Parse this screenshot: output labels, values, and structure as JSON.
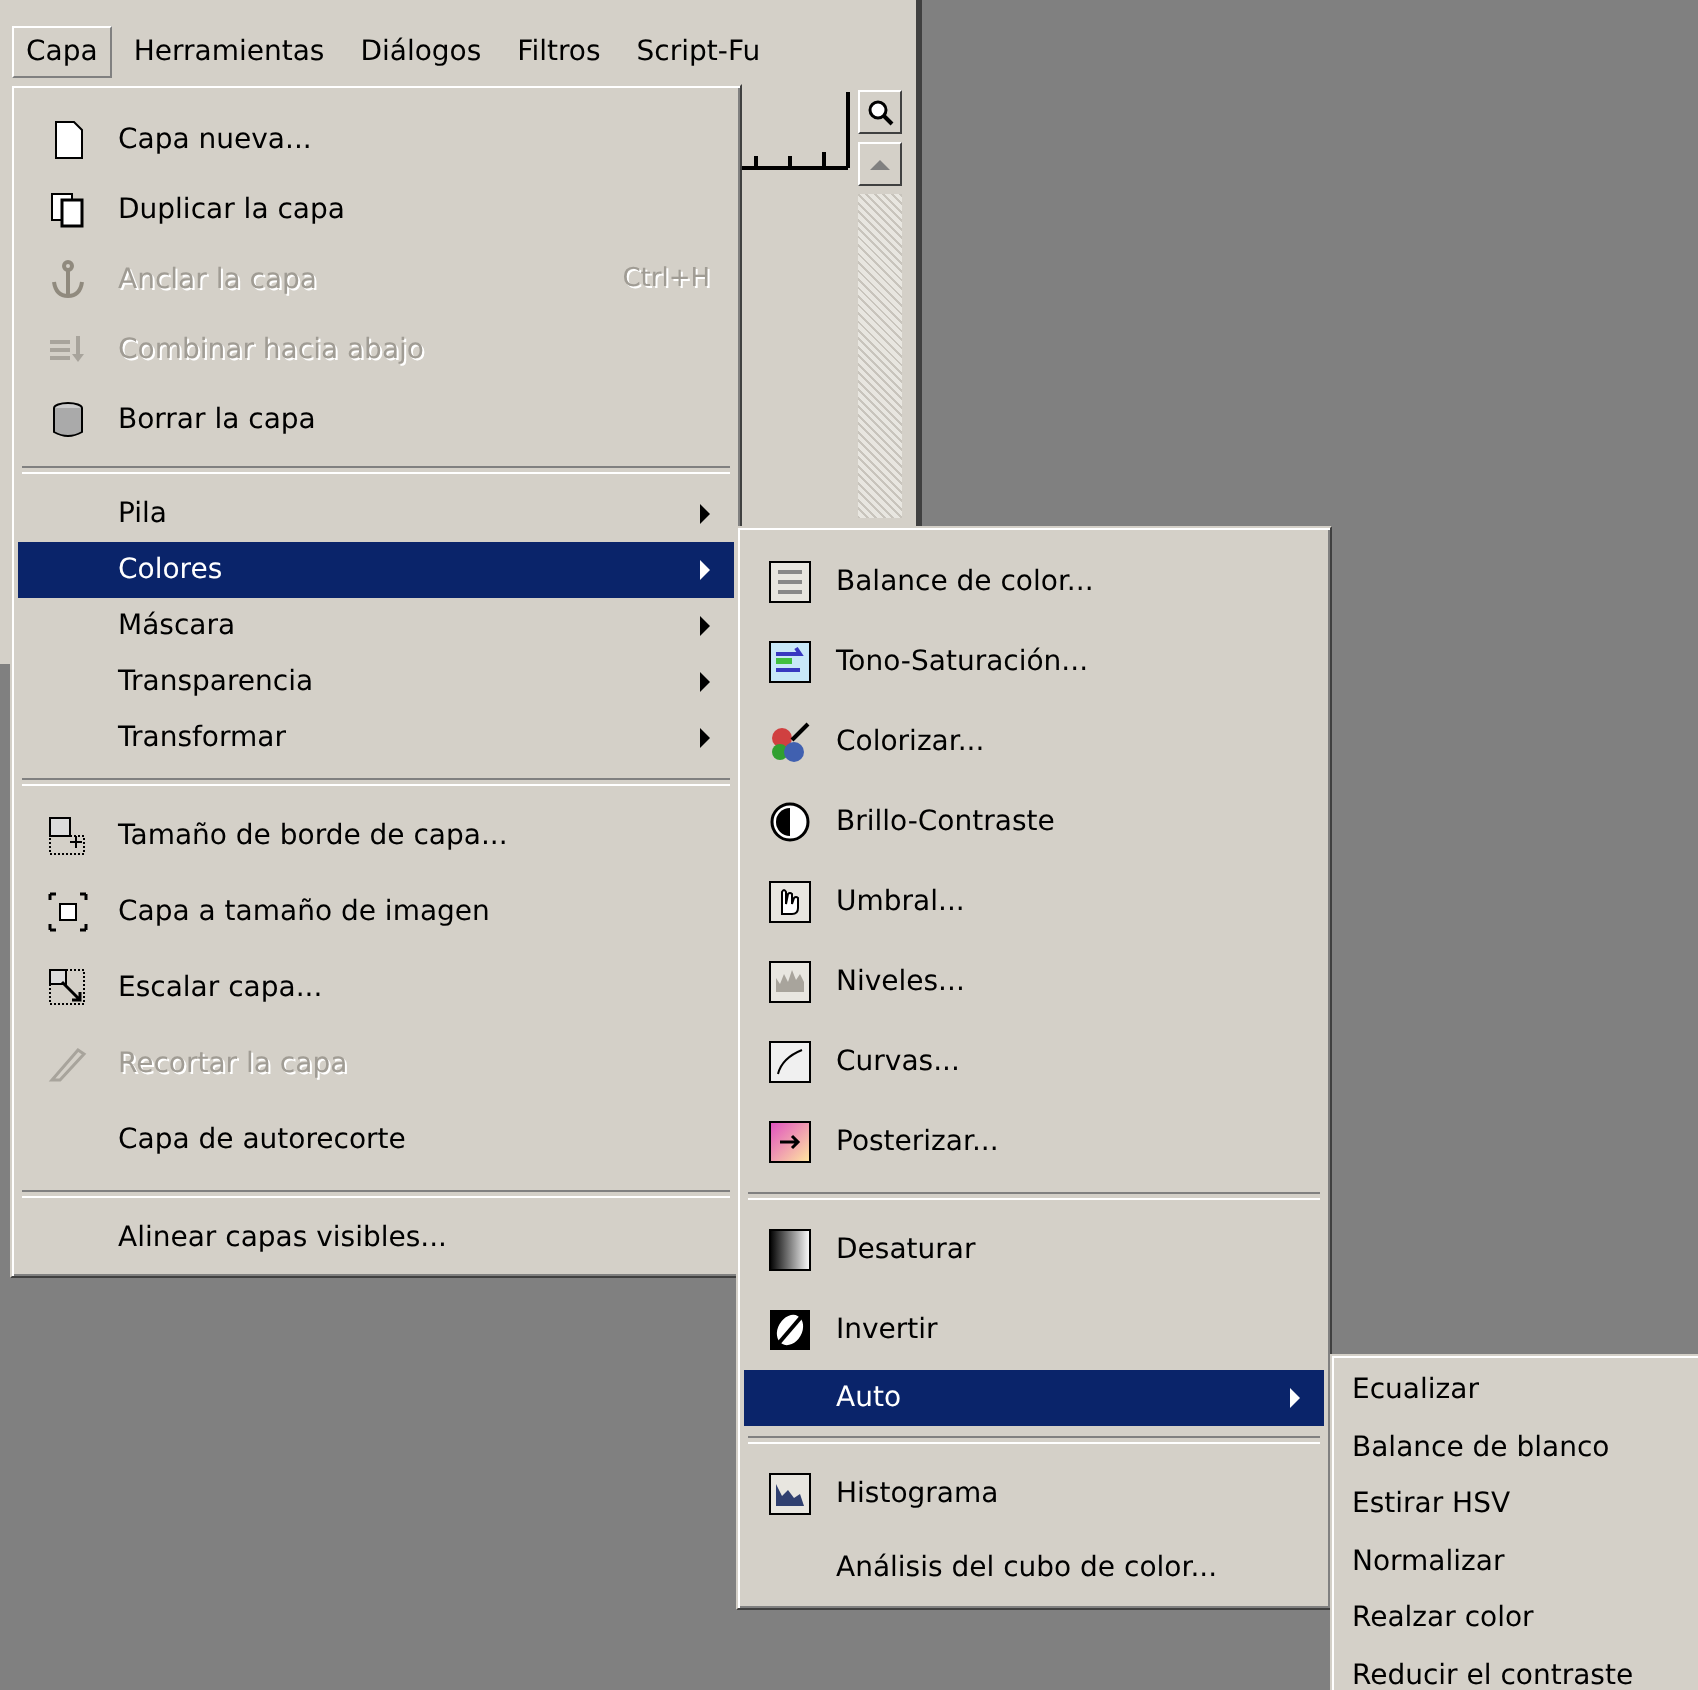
{
  "menubar": [
    {
      "label": "Capa",
      "selected": true
    },
    {
      "label": "Herramientas",
      "selected": false
    },
    {
      "label": "Diálogos",
      "selected": false
    },
    {
      "label": "Filtros",
      "selected": false
    },
    {
      "label": "Script-Fu",
      "selected": false
    }
  ],
  "layer_menu": [
    {
      "kind": "item",
      "label": "Capa nueva...",
      "disabled": false,
      "selected": false,
      "submenu": false
    },
    {
      "kind": "item",
      "label": "Duplicar la capa",
      "disabled": false,
      "selected": false,
      "submenu": false
    },
    {
      "kind": "item",
      "label": "Anclar la capa",
      "shortcut": "Ctrl+H",
      "disabled": true,
      "selected": false,
      "submenu": false
    },
    {
      "kind": "item",
      "label": "Combinar hacia abajo",
      "disabled": true,
      "selected": false,
      "submenu": false
    },
    {
      "kind": "item",
      "label": "Borrar la capa",
      "disabled": false,
      "selected": false,
      "submenu": false
    },
    {
      "kind": "separator"
    },
    {
      "kind": "item",
      "label": "Pila",
      "disabled": false,
      "selected": false,
      "submenu": true
    },
    {
      "kind": "item",
      "label": "Colores",
      "disabled": false,
      "selected": true,
      "submenu": true
    },
    {
      "kind": "item",
      "label": "Máscara",
      "disabled": false,
      "selected": false,
      "submenu": true
    },
    {
      "kind": "item",
      "label": "Transparencia",
      "disabled": false,
      "selected": false,
      "submenu": true
    },
    {
      "kind": "item",
      "label": "Transformar",
      "disabled": false,
      "selected": false,
      "submenu": true
    },
    {
      "kind": "separator"
    },
    {
      "kind": "item",
      "label": "Tamaño de borde de capa...",
      "disabled": false,
      "selected": false,
      "submenu": false
    },
    {
      "kind": "item",
      "label": "Capa a tamaño de imagen",
      "disabled": false,
      "selected": false,
      "submenu": false
    },
    {
      "kind": "item",
      "label": "Escalar capa...",
      "disabled": false,
      "selected": false,
      "submenu": false
    },
    {
      "kind": "item",
      "label": "Recortar la capa",
      "disabled": true,
      "selected": false,
      "submenu": false
    },
    {
      "kind": "item",
      "label": "Capa de autorecorte",
      "disabled": false,
      "selected": false,
      "submenu": false
    },
    {
      "kind": "separator"
    },
    {
      "kind": "item",
      "label": "Alinear capas visibles...",
      "disabled": false,
      "selected": false,
      "submenu": false
    }
  ],
  "colors_menu": [
    {
      "kind": "item",
      "label": "Balance de color...",
      "disabled": false,
      "selected": false,
      "submenu": false
    },
    {
      "kind": "item",
      "label": "Tono-Saturación...",
      "disabled": false,
      "selected": false,
      "submenu": false
    },
    {
      "kind": "item",
      "label": "Colorizar...",
      "disabled": false,
      "selected": false,
      "submenu": false
    },
    {
      "kind": "item",
      "label": "Brillo-Contraste",
      "disabled": false,
      "selected": false,
      "submenu": false
    },
    {
      "kind": "item",
      "label": "Umbral...",
      "disabled": false,
      "selected": false,
      "submenu": false
    },
    {
      "kind": "item",
      "label": "Niveles...",
      "disabled": false,
      "selected": false,
      "submenu": false
    },
    {
      "kind": "item",
      "label": "Curvas...",
      "disabled": false,
      "selected": false,
      "submenu": false
    },
    {
      "kind": "item",
      "label": "Posterizar...",
      "disabled": false,
      "selected": false,
      "submenu": false
    },
    {
      "kind": "separator"
    },
    {
      "kind": "item",
      "label": "Desaturar",
      "disabled": false,
      "selected": false,
      "submenu": false
    },
    {
      "kind": "item",
      "label": "Invertir",
      "disabled": false,
      "selected": false,
      "submenu": false
    },
    {
      "kind": "item",
      "label": "Auto",
      "disabled": false,
      "selected": true,
      "submenu": true
    },
    {
      "kind": "separator"
    },
    {
      "kind": "item",
      "label": "Histograma",
      "disabled": false,
      "selected": false,
      "submenu": false
    },
    {
      "kind": "item",
      "label": "Análisis del cubo de color...",
      "disabled": false,
      "selected": false,
      "submenu": false
    }
  ],
  "auto_menu": [
    {
      "kind": "item",
      "label": "Ecualizar",
      "disabled": false,
      "selected": false,
      "submenu": false
    },
    {
      "kind": "item",
      "label": "Balance de blanco",
      "disabled": false,
      "selected": false,
      "submenu": false
    },
    {
      "kind": "item",
      "label": "Estirar HSV",
      "disabled": false,
      "selected": false,
      "submenu": false
    },
    {
      "kind": "item",
      "label": "Normalizar",
      "disabled": false,
      "selected": false,
      "submenu": false
    },
    {
      "kind": "item",
      "label": "Realzar color",
      "disabled": false,
      "selected": false,
      "submenu": false
    },
    {
      "kind": "item",
      "label": "Reducir el contraste",
      "disabled": false,
      "selected": false,
      "submenu": false
    }
  ]
}
